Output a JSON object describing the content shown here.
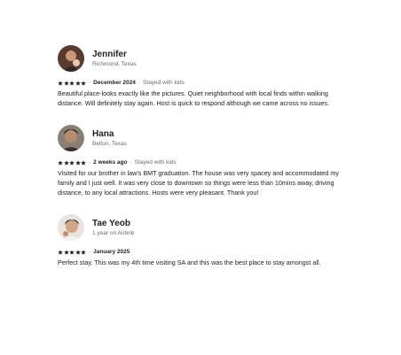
{
  "reviews": [
    {
      "name": "Jennifer",
      "subtitle": "Richmond, Texas",
      "rating": 5,
      "date": "December 2024",
      "tag": "Stayed with kids",
      "text": "Beautiful place-looks exactly like the pictures. Quiet neighborhood with local finds within walking distance. Will definitely stay again. Host is quick to respond although we came across no issues."
    },
    {
      "name": "Hana",
      "subtitle": "Belton, Texas",
      "rating": 5,
      "date": "2 weeks ago",
      "tag": "Stayed with kids",
      "text": "Visited for our brother in law's BMT graduation. The house was very spacey and accommodated my family and I just well. It was very close to downtown so things were less than 10mins away, driving distance, to any local attractions. Hosts were very pleasant. Thank you!"
    },
    {
      "name": "Tae Yeob",
      "subtitle": "1 year on Airbnb",
      "rating": 5,
      "date": "January 2025",
      "tag": "",
      "text": "Perfect stay. This was my 4th time visiting SA and this was the best place to stay amongst all."
    }
  ],
  "star_symbol": "★",
  "separator": "·",
  "colors": {
    "text": "#222222",
    "muted": "#6a6a6a",
    "star": "#222222"
  }
}
